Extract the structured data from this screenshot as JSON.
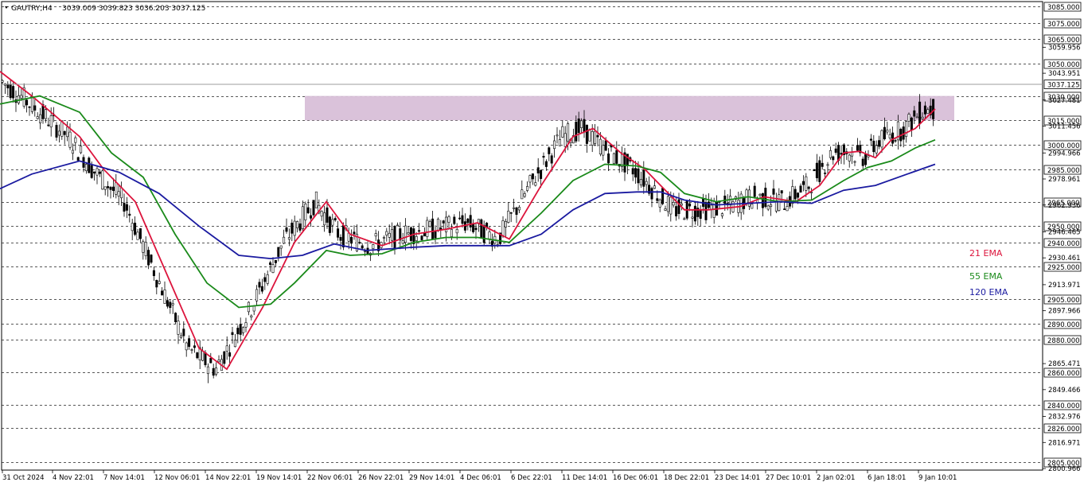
{
  "header": {
    "symbol": "GAUTRY,H4",
    "ohlc": "3039.009 3039.823 3036.203 3037.125"
  },
  "chart_data": {
    "type": "candlestick",
    "y_range": [
      2800,
      3088
    ],
    "current_price": "3037.125",
    "level_labels": [
      "3085.000",
      "3075.000",
      "3065.000",
      "3050.000",
      "3030.000",
      "3015.000",
      "3000.000",
      "2985.000",
      "2965.000",
      "2950.000",
      "2940.000",
      "2925.000",
      "2905.000",
      "2890.000",
      "2880.000",
      "2860.000",
      "2840.000",
      "2826.000",
      "2805.000"
    ],
    "tick_labels": [
      "3059.956",
      "3043.951",
      "3027.481",
      "3011.456",
      "2994.966",
      "2978.961",
      "2962.936",
      "2946.465",
      "2930.461",
      "2913.971",
      "2897.966",
      "2865.471",
      "2849.466",
      "2832.976",
      "2816.971",
      "2800.966"
    ],
    "x_labels": [
      "31 Oct 2024",
      "4 Nov 22:01",
      "7 Nov 14:01",
      "12 Nov 06:01",
      "14 Nov 22:01",
      "19 Nov 14:01",
      "22 Nov 06:01",
      "26 Nov 22:01",
      "29 Nov 14:01",
      "4 Dec 06:01",
      "6 Dec 22:01",
      "11 Dec 14:01",
      "16 Dec 06:01",
      "18 Dec 22:01",
      "23 Dec 14:01",
      "27 Dec 10:01",
      "2 Jan 02:01",
      "6 Jan 18:01",
      "9 Jan 10:01"
    ],
    "zone": [
      3015,
      3030
    ],
    "legend": [
      {
        "name": "21 EMA",
        "color": "#dc143c"
      },
      {
        "name": "55 EMA",
        "color": "#1a8a1a"
      },
      {
        "name": "120 EMA",
        "color": "#1a1aa0"
      }
    ],
    "ema21": [
      [
        0,
        3045
      ],
      [
        40,
        3030
      ],
      [
        100,
        3005
      ],
      [
        130,
        2985
      ],
      [
        170,
        2965
      ],
      [
        210,
        2920
      ],
      [
        250,
        2875
      ],
      [
        285,
        2862
      ],
      [
        330,
        2900
      ],
      [
        370,
        2940
      ],
      [
        410,
        2965
      ],
      [
        440,
        2945
      ],
      [
        480,
        2938
      ],
      [
        520,
        2945
      ],
      [
        560,
        2948
      ],
      [
        600,
        2952
      ],
      [
        640,
        2942
      ],
      [
        680,
        2975
      ],
      [
        720,
        3005
      ],
      [
        745,
        3010
      ],
      [
        780,
        2995
      ],
      [
        810,
        2985
      ],
      [
        830,
        2975
      ],
      [
        860,
        2960
      ],
      [
        890,
        2960
      ],
      [
        930,
        2962
      ],
      [
        960,
        2968
      ],
      [
        1000,
        2965
      ],
      [
        1030,
        2975
      ],
      [
        1060,
        2995
      ],
      [
        1080,
        2996
      ],
      [
        1100,
        2992
      ],
      [
        1120,
        3003
      ],
      [
        1150,
        3010
      ],
      [
        1175,
        3022
      ]
    ],
    "ema55": [
      [
        0,
        3025
      ],
      [
        50,
        3030
      ],
      [
        100,
        3020
      ],
      [
        140,
        2995
      ],
      [
        180,
        2980
      ],
      [
        220,
        2945
      ],
      [
        260,
        2915
      ],
      [
        300,
        2900
      ],
      [
        340,
        2902
      ],
      [
        370,
        2915
      ],
      [
        410,
        2935
      ],
      [
        440,
        2932
      ],
      [
        480,
        2933
      ],
      [
        520,
        2940
      ],
      [
        560,
        2943
      ],
      [
        600,
        2943
      ],
      [
        640,
        2940
      ],
      [
        680,
        2958
      ],
      [
        720,
        2978
      ],
      [
        760,
        2988
      ],
      [
        800,
        2987
      ],
      [
        830,
        2983
      ],
      [
        860,
        2970
      ],
      [
        900,
        2965
      ],
      [
        940,
        2968
      ],
      [
        980,
        2965
      ],
      [
        1020,
        2966
      ],
      [
        1060,
        2978
      ],
      [
        1090,
        2986
      ],
      [
        1120,
        2990
      ],
      [
        1150,
        2998
      ],
      [
        1175,
        3003
      ]
    ],
    "ema120": [
      [
        0,
        2973
      ],
      [
        40,
        2982
      ],
      [
        100,
        2990
      ],
      [
        150,
        2983
      ],
      [
        200,
        2970
      ],
      [
        250,
        2950
      ],
      [
        300,
        2932
      ],
      [
        340,
        2930
      ],
      [
        380,
        2932
      ],
      [
        420,
        2939
      ],
      [
        460,
        2935
      ],
      [
        520,
        2937
      ],
      [
        560,
        2938
      ],
      [
        600,
        2938
      ],
      [
        640,
        2938
      ],
      [
        680,
        2945
      ],
      [
        720,
        2960
      ],
      [
        760,
        2970
      ],
      [
        800,
        2971
      ],
      [
        830,
        2971
      ],
      [
        860,
        2966
      ],
      [
        900,
        2963
      ],
      [
        940,
        2964
      ],
      [
        980,
        2965
      ],
      [
        1020,
        2964
      ],
      [
        1060,
        2972
      ],
      [
        1100,
        2975
      ],
      [
        1140,
        2982
      ],
      [
        1175,
        2988
      ]
    ]
  }
}
